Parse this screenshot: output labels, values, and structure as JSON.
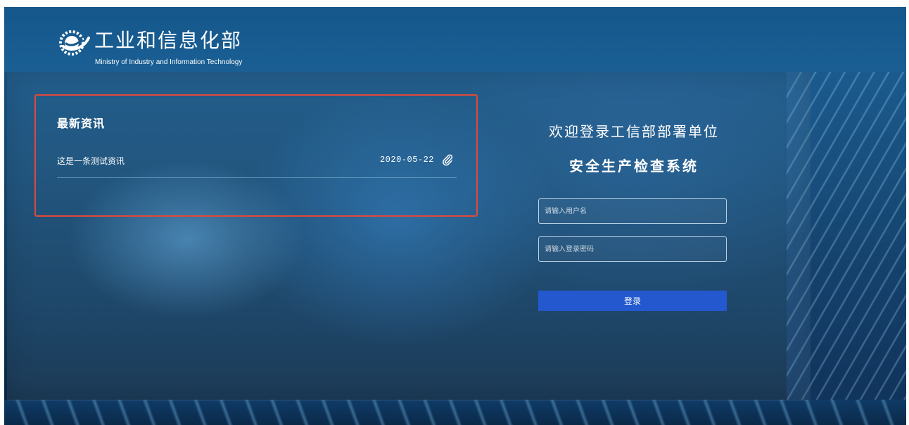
{
  "header": {
    "logo_title": "工业和信息化部",
    "logo_subtitle": "Ministry of Industry and Information Technology",
    "logo_icon": "miit-emblem-icon"
  },
  "news": {
    "title": "最新资讯",
    "items": [
      {
        "text": "这是一条测试资讯",
        "date": "2020-05-22",
        "icon": "paperclip-icon"
      }
    ]
  },
  "login": {
    "title_line1": "欢迎登录工信部部署单位",
    "title_line2": "安全生产检查系统",
    "username_placeholder": "请输入用户名",
    "password_placeholder": "请输入登录密码",
    "submit_label": "登录"
  },
  "colors": {
    "highlight_border": "#e1483a",
    "button": "#2358cf"
  }
}
